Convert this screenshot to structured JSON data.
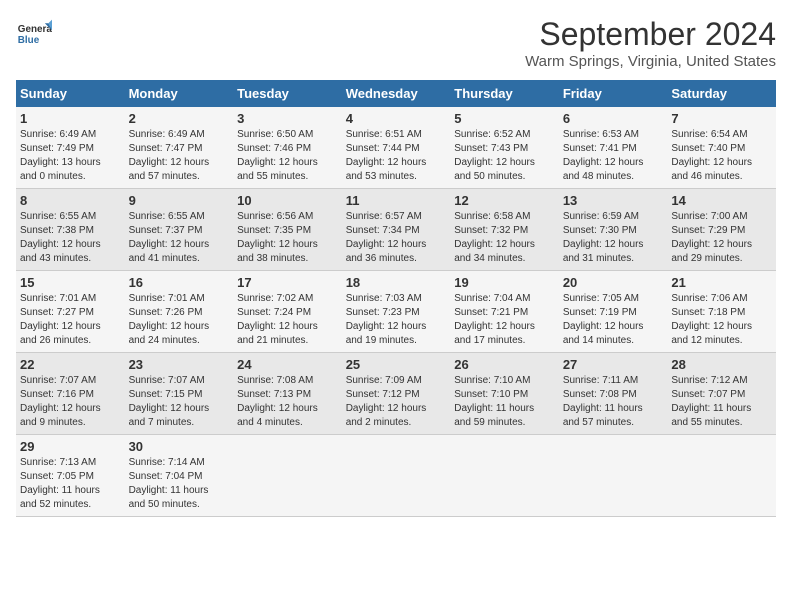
{
  "header": {
    "logo_line1": "General",
    "logo_line2": "Blue",
    "title": "September 2024",
    "subtitle": "Warm Springs, Virginia, United States"
  },
  "columns": [
    "Sunday",
    "Monday",
    "Tuesday",
    "Wednesday",
    "Thursday",
    "Friday",
    "Saturday"
  ],
  "weeks": [
    [
      {
        "day": "1",
        "info": "Sunrise: 6:49 AM\nSunset: 7:49 PM\nDaylight: 13 hours\nand 0 minutes."
      },
      {
        "day": "2",
        "info": "Sunrise: 6:49 AM\nSunset: 7:47 PM\nDaylight: 12 hours\nand 57 minutes."
      },
      {
        "day": "3",
        "info": "Sunrise: 6:50 AM\nSunset: 7:46 PM\nDaylight: 12 hours\nand 55 minutes."
      },
      {
        "day": "4",
        "info": "Sunrise: 6:51 AM\nSunset: 7:44 PM\nDaylight: 12 hours\nand 53 minutes."
      },
      {
        "day": "5",
        "info": "Sunrise: 6:52 AM\nSunset: 7:43 PM\nDaylight: 12 hours\nand 50 minutes."
      },
      {
        "day": "6",
        "info": "Sunrise: 6:53 AM\nSunset: 7:41 PM\nDaylight: 12 hours\nand 48 minutes."
      },
      {
        "day": "7",
        "info": "Sunrise: 6:54 AM\nSunset: 7:40 PM\nDaylight: 12 hours\nand 46 minutes."
      }
    ],
    [
      {
        "day": "8",
        "info": "Sunrise: 6:55 AM\nSunset: 7:38 PM\nDaylight: 12 hours\nand 43 minutes."
      },
      {
        "day": "9",
        "info": "Sunrise: 6:55 AM\nSunset: 7:37 PM\nDaylight: 12 hours\nand 41 minutes."
      },
      {
        "day": "10",
        "info": "Sunrise: 6:56 AM\nSunset: 7:35 PM\nDaylight: 12 hours\nand 38 minutes."
      },
      {
        "day": "11",
        "info": "Sunrise: 6:57 AM\nSunset: 7:34 PM\nDaylight: 12 hours\nand 36 minutes."
      },
      {
        "day": "12",
        "info": "Sunrise: 6:58 AM\nSunset: 7:32 PM\nDaylight: 12 hours\nand 34 minutes."
      },
      {
        "day": "13",
        "info": "Sunrise: 6:59 AM\nSunset: 7:30 PM\nDaylight: 12 hours\nand 31 minutes."
      },
      {
        "day": "14",
        "info": "Sunrise: 7:00 AM\nSunset: 7:29 PM\nDaylight: 12 hours\nand 29 minutes."
      }
    ],
    [
      {
        "day": "15",
        "info": "Sunrise: 7:01 AM\nSunset: 7:27 PM\nDaylight: 12 hours\nand 26 minutes."
      },
      {
        "day": "16",
        "info": "Sunrise: 7:01 AM\nSunset: 7:26 PM\nDaylight: 12 hours\nand 24 minutes."
      },
      {
        "day": "17",
        "info": "Sunrise: 7:02 AM\nSunset: 7:24 PM\nDaylight: 12 hours\nand 21 minutes."
      },
      {
        "day": "18",
        "info": "Sunrise: 7:03 AM\nSunset: 7:23 PM\nDaylight: 12 hours\nand 19 minutes."
      },
      {
        "day": "19",
        "info": "Sunrise: 7:04 AM\nSunset: 7:21 PM\nDaylight: 12 hours\nand 17 minutes."
      },
      {
        "day": "20",
        "info": "Sunrise: 7:05 AM\nSunset: 7:19 PM\nDaylight: 12 hours\nand 14 minutes."
      },
      {
        "day": "21",
        "info": "Sunrise: 7:06 AM\nSunset: 7:18 PM\nDaylight: 12 hours\nand 12 minutes."
      }
    ],
    [
      {
        "day": "22",
        "info": "Sunrise: 7:07 AM\nSunset: 7:16 PM\nDaylight: 12 hours\nand 9 minutes."
      },
      {
        "day": "23",
        "info": "Sunrise: 7:07 AM\nSunset: 7:15 PM\nDaylight: 12 hours\nand 7 minutes."
      },
      {
        "day": "24",
        "info": "Sunrise: 7:08 AM\nSunset: 7:13 PM\nDaylight: 12 hours\nand 4 minutes."
      },
      {
        "day": "25",
        "info": "Sunrise: 7:09 AM\nSunset: 7:12 PM\nDaylight: 12 hours\nand 2 minutes."
      },
      {
        "day": "26",
        "info": "Sunrise: 7:10 AM\nSunset: 7:10 PM\nDaylight: 11 hours\nand 59 minutes."
      },
      {
        "day": "27",
        "info": "Sunrise: 7:11 AM\nSunset: 7:08 PM\nDaylight: 11 hours\nand 57 minutes."
      },
      {
        "day": "28",
        "info": "Sunrise: 7:12 AM\nSunset: 7:07 PM\nDaylight: 11 hours\nand 55 minutes."
      }
    ],
    [
      {
        "day": "29",
        "info": "Sunrise: 7:13 AM\nSunset: 7:05 PM\nDaylight: 11 hours\nand 52 minutes."
      },
      {
        "day": "30",
        "info": "Sunrise: 7:14 AM\nSunset: 7:04 PM\nDaylight: 11 hours\nand 50 minutes."
      },
      {
        "day": "",
        "info": ""
      },
      {
        "day": "",
        "info": ""
      },
      {
        "day": "",
        "info": ""
      },
      {
        "day": "",
        "info": ""
      },
      {
        "day": "",
        "info": ""
      }
    ]
  ]
}
